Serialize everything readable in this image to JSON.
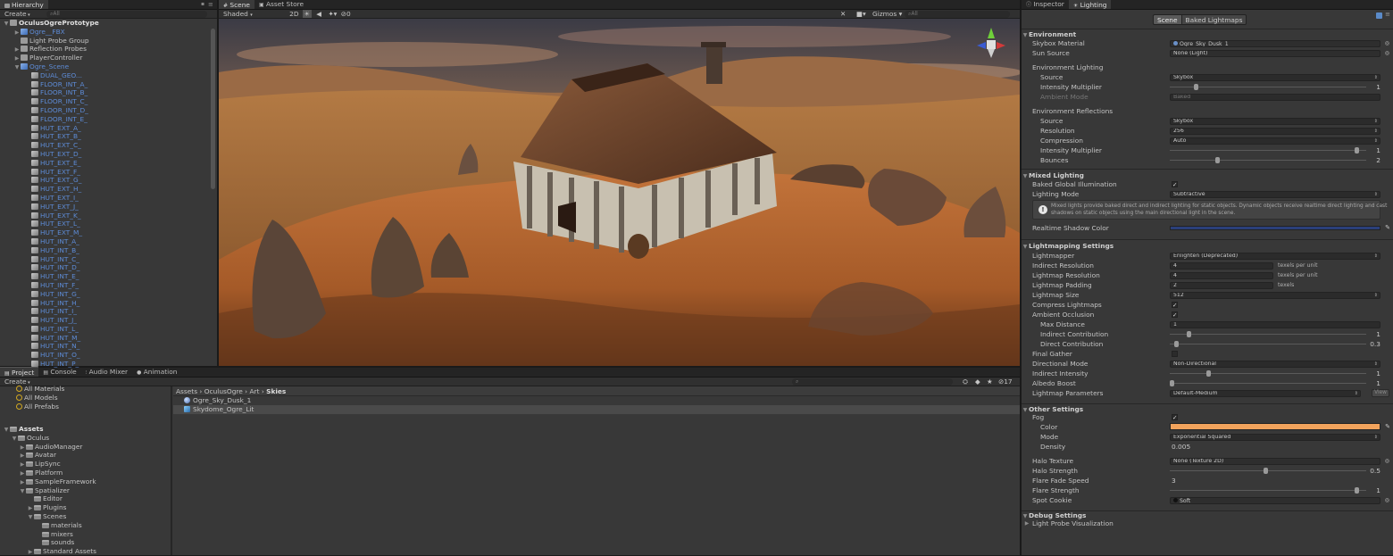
{
  "hierarchy": {
    "tab": "Hierarchy",
    "create": "Create",
    "search_placeholder": "All",
    "items": [
      {
        "label": "OculusOgrePrototype",
        "indent": 0,
        "arrow": "▼",
        "icon": "unity-scene-icon",
        "blue": false,
        "bold": true
      },
      {
        "label": "Ogre__FBX",
        "indent": 1,
        "arrow": "▶",
        "icon": "gameobject-icon",
        "blue": true
      },
      {
        "label": "Light Probe Group",
        "indent": 1,
        "arrow": "",
        "icon": "gameobject-icon",
        "blue": false
      },
      {
        "label": "Reflection Probes",
        "indent": 1,
        "arrow": "▶",
        "icon": "gameobject-icon",
        "blue": false
      },
      {
        "label": "PlayerController",
        "indent": 1,
        "arrow": "▶",
        "icon": "gameobject-icon",
        "blue": false
      },
      {
        "label": "Ogre_Scene",
        "indent": 1,
        "arrow": "▼",
        "icon": "gameobject-icon",
        "blue": true
      },
      {
        "label": "DUAL_GEO...",
        "indent": 2,
        "arrow": "",
        "icon": "mesh-icon",
        "blue": true
      },
      {
        "label": "FLOOR_INT_A_",
        "indent": 2,
        "arrow": "",
        "icon": "mesh-icon",
        "blue": true
      },
      {
        "label": "FLOOR_INT_B_",
        "indent": 2,
        "arrow": "",
        "icon": "mesh-icon",
        "blue": true
      },
      {
        "label": "FLOOR_INT_C_",
        "indent": 2,
        "arrow": "",
        "icon": "mesh-icon",
        "blue": true
      },
      {
        "label": "FLOOR_INT_D_",
        "indent": 2,
        "arrow": "",
        "icon": "mesh-icon",
        "blue": true
      },
      {
        "label": "FLOOR_INT_E_",
        "indent": 2,
        "arrow": "",
        "icon": "mesh-icon",
        "blue": true
      },
      {
        "label": "HUT_EXT_A_",
        "indent": 2,
        "arrow": "",
        "icon": "mesh-icon",
        "blue": true
      },
      {
        "label": "HUT_EXT_B_",
        "indent": 2,
        "arrow": "",
        "icon": "mesh-icon",
        "blue": true
      },
      {
        "label": "HUT_EXT_C_",
        "indent": 2,
        "arrow": "",
        "icon": "mesh-icon",
        "blue": true
      },
      {
        "label": "HUT_EXT_D_",
        "indent": 2,
        "arrow": "",
        "icon": "mesh-icon",
        "blue": true
      },
      {
        "label": "HUT_EXT_E_",
        "indent": 2,
        "arrow": "",
        "icon": "mesh-icon",
        "blue": true
      },
      {
        "label": "HUT_EXT_F_",
        "indent": 2,
        "arrow": "",
        "icon": "mesh-icon",
        "blue": true
      },
      {
        "label": "HUT_EXT_G_",
        "indent": 2,
        "arrow": "",
        "icon": "mesh-icon",
        "blue": true
      },
      {
        "label": "HUT_EXT_H_",
        "indent": 2,
        "arrow": "",
        "icon": "mesh-icon",
        "blue": true
      },
      {
        "label": "HUT_EXT_I_",
        "indent": 2,
        "arrow": "",
        "icon": "mesh-icon",
        "blue": true
      },
      {
        "label": "HUT_EXT_J_",
        "indent": 2,
        "arrow": "",
        "icon": "mesh-icon",
        "blue": true
      },
      {
        "label": "HUT_EXT_K_",
        "indent": 2,
        "arrow": "",
        "icon": "mesh-icon",
        "blue": true
      },
      {
        "label": "HUT_EXT_L_",
        "indent": 2,
        "arrow": "",
        "icon": "mesh-icon",
        "blue": true
      },
      {
        "label": "HUT_EXT_M_",
        "indent": 2,
        "arrow": "",
        "icon": "mesh-icon",
        "blue": true
      },
      {
        "label": "HUT_INT_A_",
        "indent": 2,
        "arrow": "",
        "icon": "mesh-icon",
        "blue": true
      },
      {
        "label": "HUT_INT_B_",
        "indent": 2,
        "arrow": "",
        "icon": "mesh-icon",
        "blue": true
      },
      {
        "label": "HUT_INT_C_",
        "indent": 2,
        "arrow": "",
        "icon": "mesh-icon",
        "blue": true
      },
      {
        "label": "HUT_INT_D_",
        "indent": 2,
        "arrow": "",
        "icon": "mesh-icon",
        "blue": true
      },
      {
        "label": "HUT_INT_E_",
        "indent": 2,
        "arrow": "",
        "icon": "mesh-icon",
        "blue": true
      },
      {
        "label": "HUT_INT_F_",
        "indent": 2,
        "arrow": "",
        "icon": "mesh-icon",
        "blue": true
      },
      {
        "label": "HUT_INT_G_",
        "indent": 2,
        "arrow": "",
        "icon": "mesh-icon",
        "blue": true
      },
      {
        "label": "HUT_INT_H_",
        "indent": 2,
        "arrow": "",
        "icon": "mesh-icon",
        "blue": true
      },
      {
        "label": "HUT_INT_I_",
        "indent": 2,
        "arrow": "",
        "icon": "mesh-icon",
        "blue": true
      },
      {
        "label": "HUT_INT_J_",
        "indent": 2,
        "arrow": "",
        "icon": "mesh-icon",
        "blue": true
      },
      {
        "label": "HUT_INT_L_",
        "indent": 2,
        "arrow": "",
        "icon": "mesh-icon",
        "blue": true
      },
      {
        "label": "HUT_INT_M_",
        "indent": 2,
        "arrow": "",
        "icon": "mesh-icon",
        "blue": true
      },
      {
        "label": "HUT_INT_N_",
        "indent": 2,
        "arrow": "",
        "icon": "mesh-icon",
        "blue": true
      },
      {
        "label": "HUT_INT_O_",
        "indent": 2,
        "arrow": "",
        "icon": "mesh-icon",
        "blue": true
      },
      {
        "label": "HUT_INT_P_",
        "indent": 2,
        "arrow": "",
        "icon": "mesh-icon",
        "blue": true
      }
    ]
  },
  "scene": {
    "tabs": [
      "Scene",
      "Asset Store"
    ],
    "shading_mode": "Shaded",
    "mode_2d": "2D",
    "fx_count": "0",
    "gizmos": "Gizmos",
    "search_placeholder": "All"
  },
  "project": {
    "tabs": [
      "Project",
      "Console",
      "Audio Mixer",
      "Animation"
    ],
    "create": "Create",
    "favorites": [
      "All Materials",
      "All Models",
      "All Prefabs"
    ],
    "hidden_count": "17",
    "tree": [
      {
        "label": "Assets",
        "indent": 0,
        "arrow": "▼",
        "bold": true
      },
      {
        "label": "Oculus",
        "indent": 1,
        "arrow": "▼"
      },
      {
        "label": "AudioManager",
        "indent": 2,
        "arrow": "▶"
      },
      {
        "label": "Avatar",
        "indent": 2,
        "arrow": "▶"
      },
      {
        "label": "LipSync",
        "indent": 2,
        "arrow": "▶"
      },
      {
        "label": "Platform",
        "indent": 2,
        "arrow": "▶"
      },
      {
        "label": "SampleFramework",
        "indent": 2,
        "arrow": "▶"
      },
      {
        "label": "Spatializer",
        "indent": 2,
        "arrow": "▼"
      },
      {
        "label": "Editor",
        "indent": 3,
        "arrow": ""
      },
      {
        "label": "Plugins",
        "indent": 3,
        "arrow": "▶"
      },
      {
        "label": "Scenes",
        "indent": 3,
        "arrow": "▼"
      },
      {
        "label": "materials",
        "indent": 4,
        "arrow": ""
      },
      {
        "label": "mixers",
        "indent": 4,
        "arrow": ""
      },
      {
        "label": "sounds",
        "indent": 4,
        "arrow": ""
      },
      {
        "label": "Standard Assets",
        "indent": 3,
        "arrow": "▶"
      }
    ],
    "breadcrumb": [
      "Assets",
      "OculusOgre",
      "Art",
      "Skies"
    ],
    "files": [
      {
        "label": "Ogre_Sky_Dusk_1",
        "icon": "material-sphere-icon",
        "selected": false
      },
      {
        "label": "Skydome_Ogre_Lit",
        "icon": "prefab-icon",
        "selected": true
      }
    ]
  },
  "inspector": {
    "tabs": [
      "Inspector",
      "Lighting"
    ],
    "subtabs": [
      "Scene",
      "Baked Lightmaps"
    ],
    "environment": {
      "header": "Environment",
      "skybox_material_label": "Skybox Material",
      "skybox_material_value": "Ogre_Sky_Dusk_1",
      "sun_source_label": "Sun Source",
      "sun_source_value": "None (Light)",
      "env_lighting_header": "Environment Lighting",
      "source_label": "Source",
      "source_value": "Skybox",
      "intensity_label": "Intensity Multiplier",
      "intensity_value": "1",
      "ambient_mode_label": "Ambient Mode",
      "ambient_mode_value": "Baked",
      "env_reflections_header": "Environment Reflections",
      "refl_source_label": "Source",
      "refl_source_value": "Skybox",
      "resolution_label": "Resolution",
      "resolution_value": "256",
      "compression_label": "Compression",
      "compression_value": "Auto",
      "refl_intensity_label": "Intensity Multiplier",
      "refl_intensity_value": "1",
      "bounces_label": "Bounces",
      "bounces_value": "2"
    },
    "mixed": {
      "header": "Mixed Lighting",
      "bgi_label": "Baked Global Illumination",
      "lighting_mode_label": "Lighting Mode",
      "lighting_mode_value": "Subtractive",
      "info_line1": "Mixed lights provide baked direct and indirect lighting for static objects. Dynamic objects receive realtime direct lighting and cast",
      "info_line2": "shadows on static objects using the main directional light in the scene.",
      "shadow_color_label": "Realtime Shadow Color"
    },
    "lightmapping": {
      "header": "Lightmapping Settings",
      "lightmapper_label": "Lightmapper",
      "lightmapper_value": "Enlighten (Deprecated)",
      "indirect_res_label": "Indirect Resolution",
      "indirect_res_value": "4",
      "indirect_res_unit": "texels per unit",
      "lightmap_res_label": "Lightmap Resolution",
      "lightmap_res_value": "4",
      "lightmap_res_unit": "texels per unit",
      "padding_label": "Lightmap Padding",
      "padding_value": "2",
      "padding_unit": "texels",
      "size_label": "Lightmap Size",
      "size_value": "512",
      "compress_label": "Compress Lightmaps",
      "ao_label": "Ambient Occlusion",
      "max_distance_label": "Max Distance",
      "max_distance_value": "1",
      "indirect_contrib_label": "Indirect Contribution",
      "indirect_contrib_value": "1",
      "direct_contrib_label": "Direct Contribution",
      "direct_contrib_value": "0.3",
      "final_gather_label": "Final Gather",
      "directional_mode_label": "Directional Mode",
      "directional_mode_value": "Non-Directional",
      "indirect_intensity_label": "Indirect Intensity",
      "indirect_intensity_value": "1",
      "albedo_boost_label": "Albedo Boost",
      "albedo_boost_value": "1",
      "params_label": "Lightmap Parameters",
      "params_value": "Default-Medium",
      "view_button": "View"
    },
    "other": {
      "header": "Other Settings",
      "fog_label": "Fog",
      "color_label": "Color",
      "mode_label": "Mode",
      "mode_value": "Exponential Squared",
      "density_label": "Density",
      "density_value": "0.005",
      "halo_texture_label": "Halo Texture",
      "halo_texture_value": "None (Texture 2D)",
      "halo_strength_label": "Halo Strength",
      "halo_strength_value": "0.5",
      "flare_fade_label": "Flare Fade Speed",
      "flare_fade_value": "3",
      "flare_strength_label": "Flare Strength",
      "flare_strength_value": "1",
      "spot_cookie_label": "Spot Cookie",
      "spot_cookie_value": "Soft"
    },
    "debug": {
      "header": "Debug Settings",
      "probe_vis_label": "Light Probe Visualization"
    }
  },
  "colors": {
    "fog_color": "#f2a35c",
    "shadow_color": "#2a3f7a",
    "blue_text": "#5d8bd6"
  }
}
